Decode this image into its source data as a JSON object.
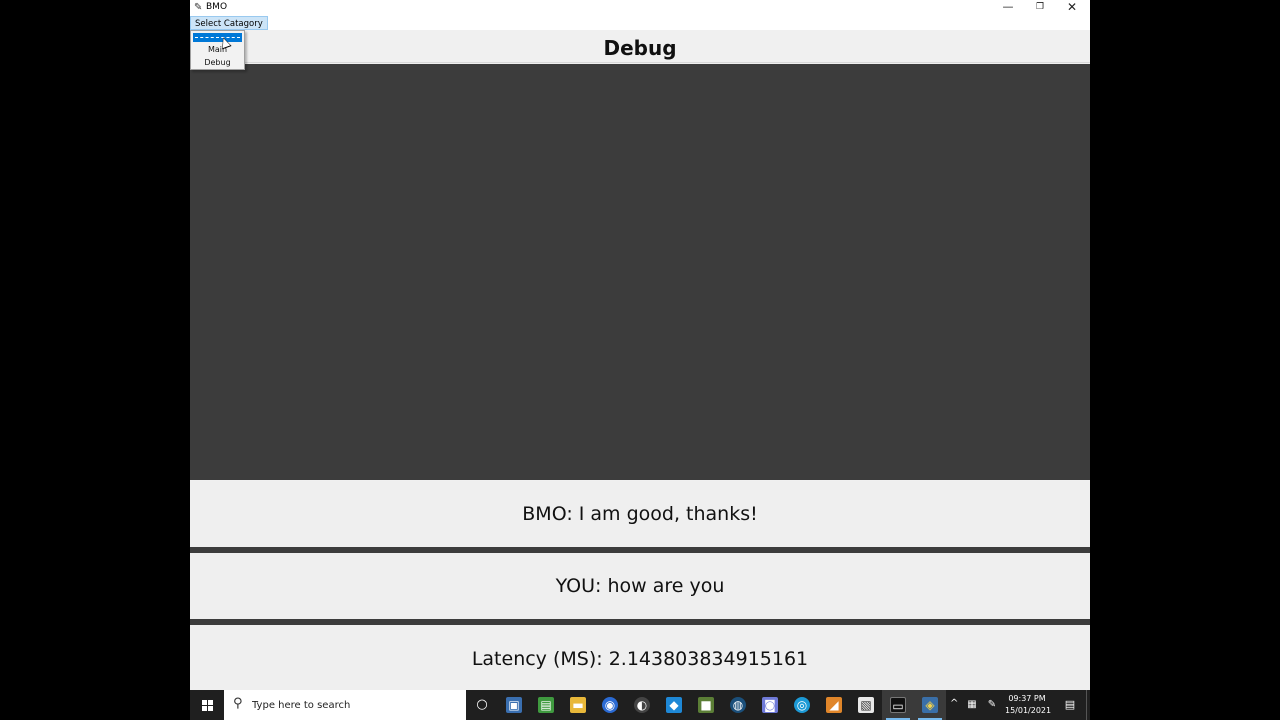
{
  "window": {
    "title": "BMO",
    "icon": "feather-icon",
    "controls": {
      "minimize": "—",
      "maximize": "❐",
      "close": "✕"
    }
  },
  "menubar": {
    "category_label": "Select Catagory"
  },
  "dropdown": {
    "items": [
      {
        "label": "Main"
      },
      {
        "label": "Debug"
      }
    ],
    "highlight_color": "#0078d7"
  },
  "header": {
    "title": "Debug"
  },
  "content": {
    "background": "#3c3c3c"
  },
  "messages": {
    "bmo": "BMO: I am good, thanks!",
    "you": "YOU: how are you",
    "latency": "Latency (MS): 2.143803834915161"
  },
  "taskbar": {
    "search_placeholder": "Type here to search",
    "apps": [
      {
        "name": "cortana-icon",
        "glyph": "○"
      },
      {
        "name": "app-icon-1",
        "glyph": "▣"
      },
      {
        "name": "app-icon-2",
        "glyph": "▤"
      },
      {
        "name": "file-explorer-icon",
        "glyph": "▬"
      },
      {
        "name": "chrome-icon",
        "glyph": "◉"
      },
      {
        "name": "obs-icon",
        "glyph": "◐"
      },
      {
        "name": "vscode-icon",
        "glyph": "◆"
      },
      {
        "name": "minecraft-icon",
        "glyph": "■"
      },
      {
        "name": "steam-icon",
        "glyph": "◍"
      },
      {
        "name": "discord-icon",
        "glyph": "◙"
      },
      {
        "name": "edge-icon",
        "glyph": "◎"
      },
      {
        "name": "sublime-icon",
        "glyph": "◢"
      },
      {
        "name": "notepad-icon",
        "glyph": "▧"
      },
      {
        "name": "terminal-icon",
        "glyph": "▭"
      },
      {
        "name": "python-icon",
        "glyph": "◈"
      }
    ],
    "clock_time": "09:37 PM",
    "clock_date": "15/01/2021",
    "tray_up": "^",
    "notification_glyph": "▤"
  }
}
